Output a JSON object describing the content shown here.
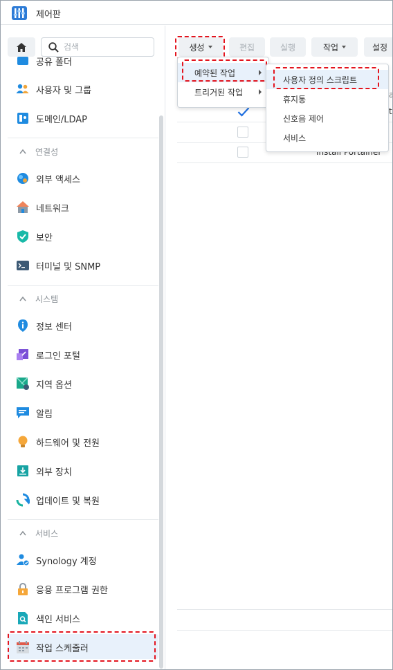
{
  "window": {
    "title": "제어판"
  },
  "sidebar": {
    "search_placeholder": "검색",
    "items": [
      {
        "label": "공유 폴더",
        "icon": "shared-folder-icon"
      },
      {
        "label": "사용자 및 그룹",
        "icon": "users-icon"
      },
      {
        "label": "도메인/LDAP",
        "icon": "domain-icon"
      },
      {
        "label": "외부 액세스",
        "icon": "external-access-icon"
      },
      {
        "label": "네트워크",
        "icon": "network-icon"
      },
      {
        "label": "보안",
        "icon": "shield-icon"
      },
      {
        "label": "터미널 및 SNMP",
        "icon": "terminal-icon"
      },
      {
        "label": "정보 센터",
        "icon": "info-icon"
      },
      {
        "label": "로그인 포털",
        "icon": "login-portal-icon"
      },
      {
        "label": "지역 옵션",
        "icon": "regional-icon"
      },
      {
        "label": "알림",
        "icon": "notification-icon"
      },
      {
        "label": "하드웨어 및 전원",
        "icon": "bulb-icon"
      },
      {
        "label": "외부 장치",
        "icon": "external-device-icon"
      },
      {
        "label": "업데이트 및 복원",
        "icon": "update-icon"
      },
      {
        "label": "Synology 계정",
        "icon": "synology-account-icon"
      },
      {
        "label": "응용 프로그램 권한",
        "icon": "lock-icon"
      },
      {
        "label": "색인 서비스",
        "icon": "index-icon"
      },
      {
        "label": "작업 스케줄러",
        "icon": "calendar-icon"
      }
    ],
    "sections": [
      {
        "label": "연결성"
      },
      {
        "label": "시스템"
      },
      {
        "label": "서비스"
      }
    ]
  },
  "toolbar": {
    "create": "생성",
    "edit": "편집",
    "run": "실행",
    "action": "작업",
    "settings": "설정"
  },
  "table": {
    "rows": [
      {
        "checked": true,
        "name": ""
      },
      {
        "checked": false,
        "name": ""
      },
      {
        "checked": false,
        "name": "Install Portainer"
      }
    ]
  },
  "create_menu": {
    "items": [
      {
        "label": "예약된 작업"
      },
      {
        "label": "트리거된 작업"
      }
    ]
  },
  "scheduled_submenu": {
    "items": [
      {
        "label": "사용자 정의 스크립트"
      },
      {
        "label": "휴지통"
      },
      {
        "label": "신호음 제어"
      },
      {
        "label": "서비스"
      }
    ]
  },
  "colors": {
    "accent": "#1f8be0",
    "highlight": "#e3141e",
    "hover": "#e8f1fb"
  }
}
